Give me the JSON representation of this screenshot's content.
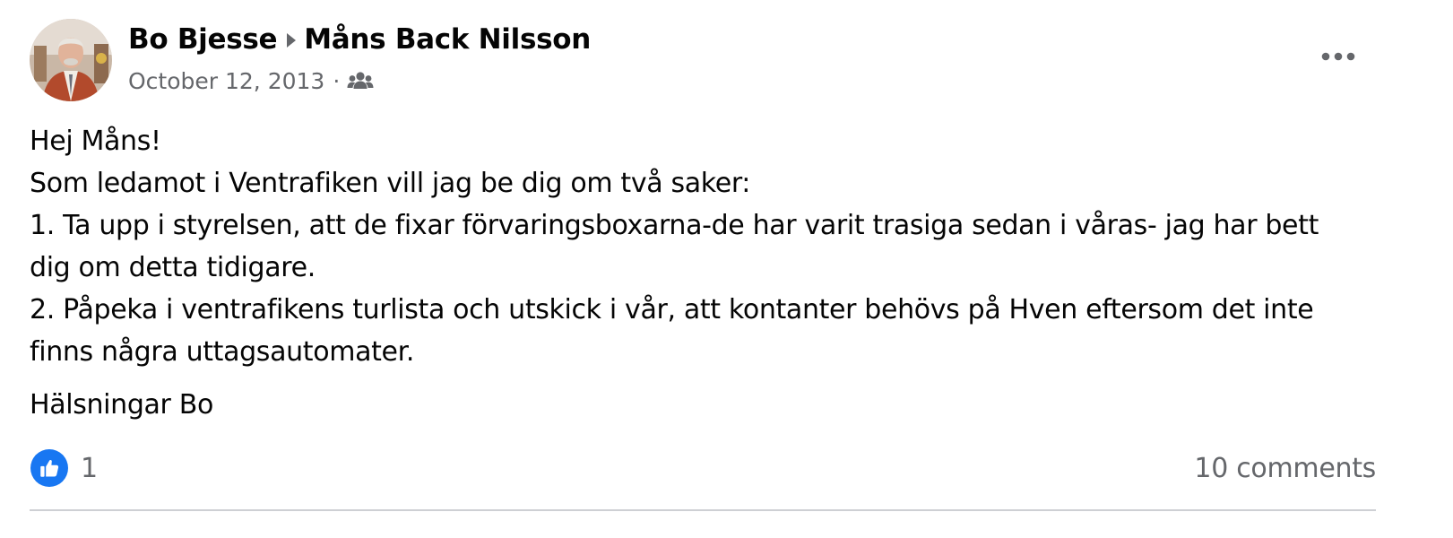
{
  "post": {
    "author": "Bo Bjesse",
    "recipient": "Måns Back Nilsson",
    "date": "October 12, 2013",
    "separator": "·",
    "privacy_icon": "friends-icon",
    "more_icon": "more-options-icon",
    "body_lines": [
      "Hej Måns!",
      "Som ledamot i Ventrafiken vill jag be dig om två saker:",
      "1. Ta upp i styrelsen, att de fixar förvaringsboxarna-de har varit trasiga sedan i våras- jag har bett",
      "dig om detta tidigare.",
      "2. Påpeka i ventrafikens turlista och utskick i vår, att kontanter behövs på Hven eftersom det inte",
      "finns några uttagsautomater."
    ],
    "signoff": "Hälsningar Bo"
  },
  "footer": {
    "reaction_icon": "like-icon",
    "reaction_count": "1",
    "comments_label": "10 comments"
  },
  "colors": {
    "text_primary": "#050505",
    "text_secondary": "#65676b",
    "like_blue": "#1877f2",
    "divider": "#ced0d4"
  }
}
